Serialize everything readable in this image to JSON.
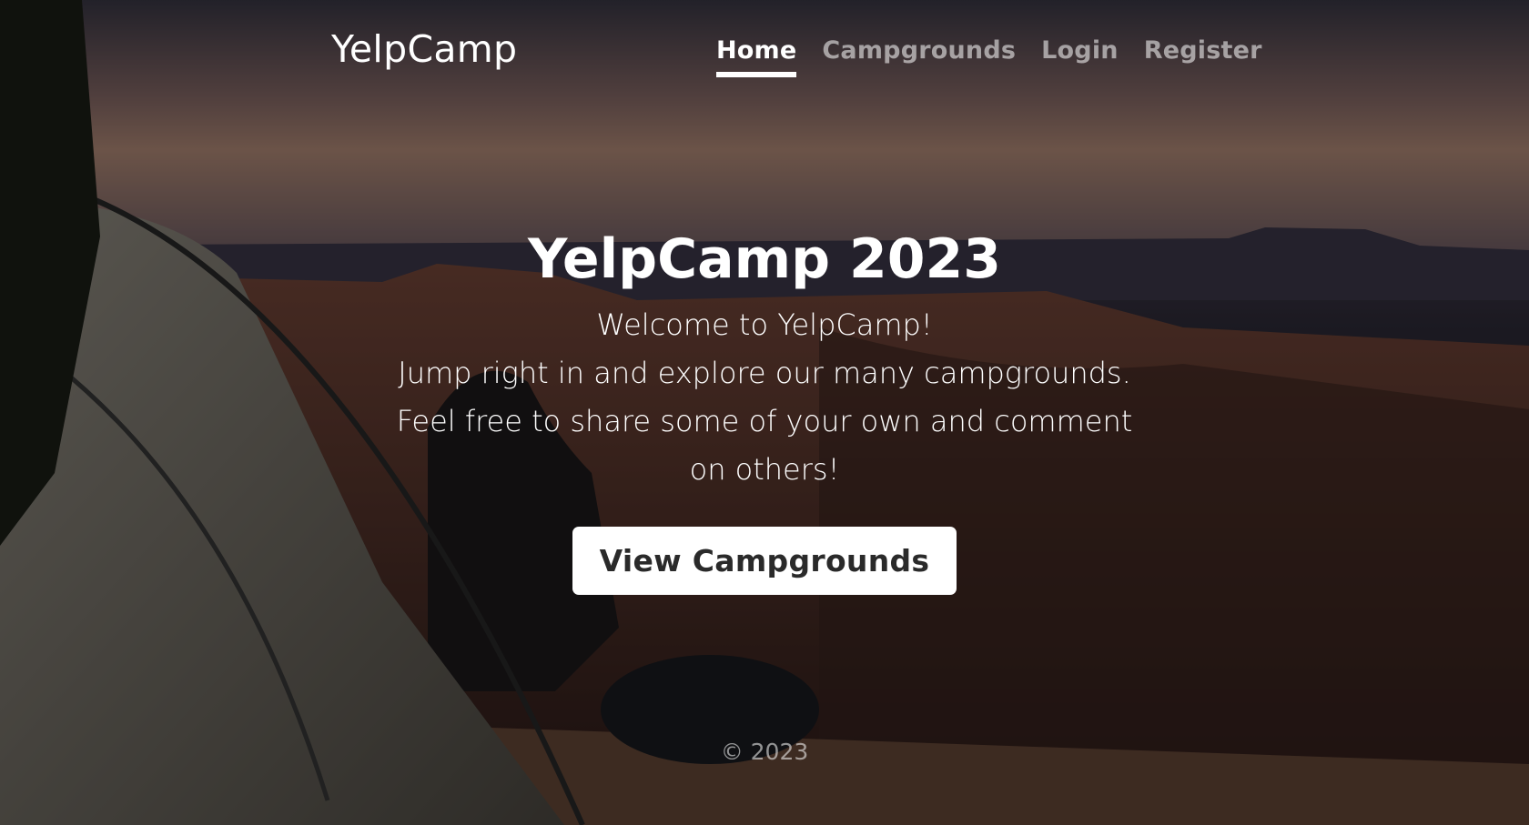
{
  "nav": {
    "brand": "YelpCamp",
    "links": [
      {
        "label": "Home",
        "active": true
      },
      {
        "label": "Campgrounds",
        "active": false
      },
      {
        "label": "Login",
        "active": false
      },
      {
        "label": "Register",
        "active": false
      }
    ]
  },
  "hero": {
    "title": "YelpCamp 2023",
    "lead_lines": [
      "Welcome to YelpCamp!",
      "Jump right in and explore our many campgrounds.",
      "Feel free to share some of your own and comment on others!"
    ],
    "cta_label": "View Campgrounds"
  },
  "footer": {
    "text": "© 2023"
  },
  "background": {
    "subject": "campsite-overlook-photo"
  }
}
